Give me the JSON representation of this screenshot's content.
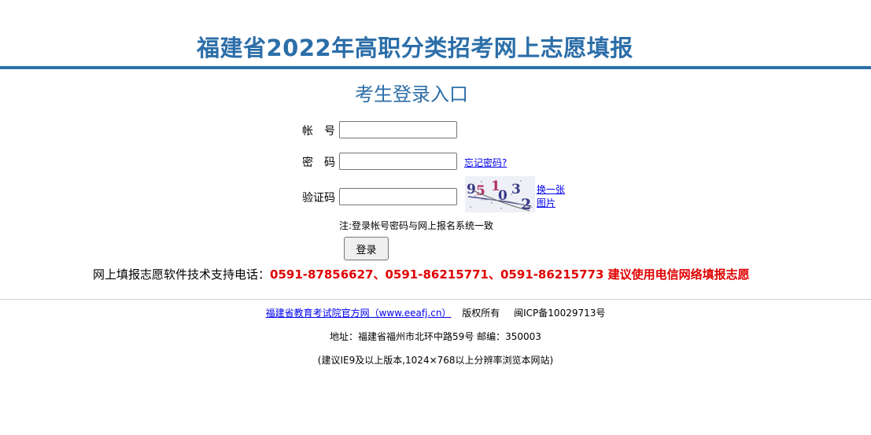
{
  "header": {
    "title": "福建省2022年高职分类招考网上志愿填报",
    "subtitle": "考生登录入口"
  },
  "login_form": {
    "account_label": "帐　号",
    "password_label": "密　码",
    "captcha_label": "验证码",
    "account_value": "",
    "password_value": "",
    "captcha_value": "",
    "forgot_password": "忘记密码?",
    "captcha_text": "95103 2",
    "refresh_captcha": "换一张图片",
    "note": "注:登录帐号密码与网上报名系统一致",
    "login_button": "登录"
  },
  "support": {
    "prefix": "网上填报志愿软件技术支持电话：",
    "phones": "0591-87856627、0591-86215771、0591-86215773 建议使用电信网络填报志愿"
  },
  "footer": {
    "site_link": "福建省教育考试院官方网（www.eeafj.cn）",
    "copyright": "版权所有",
    "icp": "闽ICP备10029713号",
    "address": "地址：福建省福州市北环中路59号 邮编：350003",
    "browser_note": "(建议IE9及以上版本,1024×768以上分辨率浏览本网站)"
  },
  "colors": {
    "brand_blue": "#2c6ea8",
    "alert_red": "#e00000",
    "link_blue": "#0000ee"
  }
}
